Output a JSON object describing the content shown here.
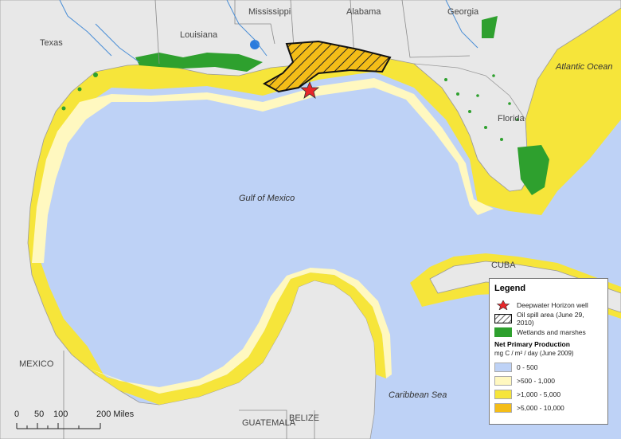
{
  "labels": {
    "mississippi": "Mississippi",
    "alabama": "Alabama",
    "georgia": "Georgia",
    "texas": "Texas",
    "louisiana": "Louisiana",
    "florida": "Florida",
    "atlantic": "Atlantic Ocean",
    "gulf": "Gulf of Mexico",
    "cuba": "CUBA",
    "mexico": "MEXICO",
    "caribbean": "Caribbean Sea",
    "guatemala": "GUATEMALA",
    "belize": "BELIZE"
  },
  "legend": {
    "title": "Legend",
    "well": "Deepwater Horizon well",
    "spill": "Oil spill area (June 29, 2010)",
    "wetlands": "Wetlands and marshes",
    "npp_title": "Net Primary Production",
    "npp_unit": "mg C / m² / day   (June 2009)",
    "classes": [
      {
        "label": "0 - 500",
        "color": "#bed2f6"
      },
      {
        "label": ">500 - 1,000",
        "color": "#fff8c0"
      },
      {
        "label": ">1,000 - 5,000",
        "color": "#f6e53a"
      },
      {
        "label": ">5,000 - 10,000",
        "color": "#f4bd18"
      }
    ]
  },
  "scale": {
    "ticks": [
      "0",
      "50",
      "100",
      "200 Miles"
    ]
  },
  "colors": {
    "water": "#bed2f6",
    "land": "#e8e8e8",
    "wetland": "#2ea02e",
    "star": "#e8262a"
  }
}
